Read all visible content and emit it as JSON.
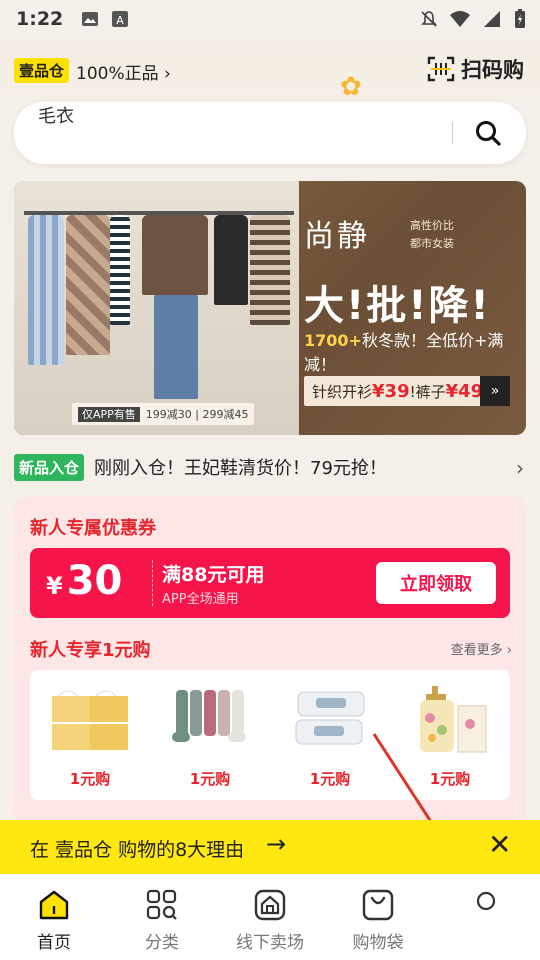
{
  "status_bar": {
    "time": "1:22"
  },
  "header": {
    "brand_badge": "壹品仓",
    "brand_text": "100%正品 ›",
    "scan_label": "扫码购"
  },
  "search": {
    "placeholder": "毛衣"
  },
  "banner": {
    "brand": "尚静",
    "brand_sub_1": "高性价比",
    "brand_sub_2": "都市女装",
    "headline": "大!批!降!",
    "line_count": "1700+",
    "line_rest": "秋冬款！全低价+满减！",
    "pill_prefix": "针织开衫",
    "pill_price1": "¥39",
    "pill_mid": "!裤子",
    "pill_price2": "¥49",
    "tag_app": "仅APP有售",
    "tag_offers": "199减30 | 299减45"
  },
  "news": {
    "badge": "新品入仓",
    "text": "刚刚入仓！王妃鞋清货价！79元抢！"
  },
  "new_user": {
    "coupon_title": "新人专属优惠券",
    "coupon_yen": "¥",
    "coupon_amount": "30",
    "coupon_condition": "满88元可用",
    "coupon_scope": "APP全场通用",
    "coupon_button": "立即领取",
    "one_yuan_title": "新人专享1元购",
    "see_more": "查看更多 ›",
    "products": [
      {
        "name": "tissue-pack",
        "price": "1元购"
      },
      {
        "name": "socks",
        "price": "1元购"
      },
      {
        "name": "wipes",
        "price": "1元购"
      },
      {
        "name": "lotion",
        "price": "1元购"
      }
    ]
  },
  "reasons": {
    "text": "在 壹品仓 购物的8大理由",
    "arrow": "→",
    "close": "✕"
  },
  "nav": [
    {
      "label": "首页",
      "icon": "home-icon"
    },
    {
      "label": "分类",
      "icon": "category-icon"
    },
    {
      "label": "线下卖场",
      "icon": "store-icon"
    },
    {
      "label": "购物袋",
      "icon": "bag-icon"
    },
    {
      "label": "",
      "icon": "profile-icon"
    }
  ],
  "colors": {
    "accent_yellow": "#ffe711",
    "sale_red": "#f6154a",
    "brand_green": "#2fb55b"
  }
}
